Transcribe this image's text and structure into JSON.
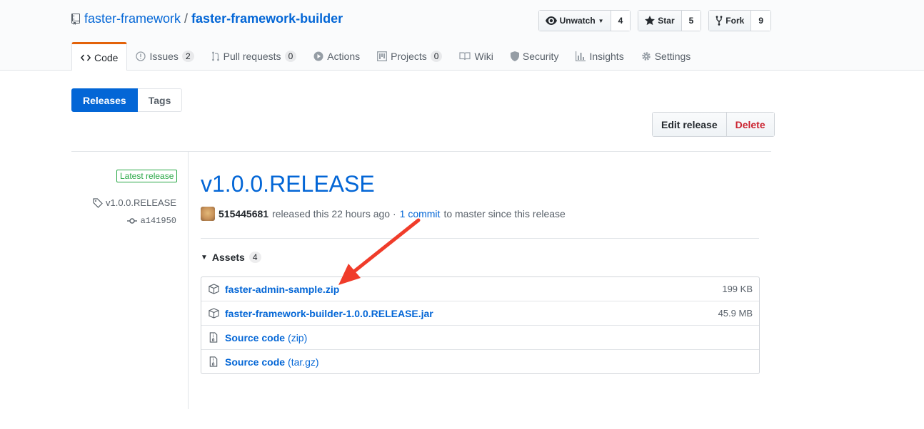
{
  "repo": {
    "owner": "faster-framework",
    "separator": "/",
    "name": "faster-framework-builder"
  },
  "header_actions": [
    {
      "label": "Unwatch",
      "count": "4",
      "icon": "eye-icon"
    },
    {
      "label": "Star",
      "count": "5",
      "icon": "star-icon"
    },
    {
      "label": "Fork",
      "count": "9",
      "icon": "fork-icon"
    }
  ],
  "tabs": [
    {
      "label": "Code",
      "icon": "code-icon",
      "selected": true
    },
    {
      "label": "Issues",
      "counter": "2",
      "icon": "issue-icon"
    },
    {
      "label": "Pull requests",
      "counter": "0",
      "icon": "pull-request-icon"
    },
    {
      "label": "Actions",
      "icon": "play-icon"
    },
    {
      "label": "Projects",
      "counter": "0",
      "icon": "project-icon"
    },
    {
      "label": "Wiki",
      "icon": "book-icon"
    },
    {
      "label": "Security",
      "icon": "shield-icon"
    },
    {
      "label": "Insights",
      "icon": "graph-icon"
    },
    {
      "label": "Settings",
      "icon": "gear-icon"
    }
  ],
  "subnav": {
    "releases": "Releases",
    "tags": "Tags"
  },
  "release_actions": {
    "edit": "Edit release",
    "delete": "Delete"
  },
  "sidebar": {
    "badge": "Latest release",
    "tag": "v1.0.0.RELEASE",
    "commit": "a141950"
  },
  "release": {
    "title": "v1.0.0.RELEASE",
    "author": "515445681",
    "released_text": "released this 22 hours ago ·",
    "commit_link": "1 commit",
    "suffix": "to master since this release"
  },
  "assets": {
    "heading": "Assets",
    "count": "4",
    "items": [
      {
        "name": "faster-admin-sample.zip",
        "size": "199 KB",
        "icon": "package-icon"
      },
      {
        "name": "faster-framework-builder-1.0.0.RELEASE.jar",
        "size": "45.9 MB",
        "icon": "package-icon"
      },
      {
        "name": "Source code",
        "ext": "(zip)",
        "icon": "file-zip-icon"
      },
      {
        "name": "Source code",
        "ext": "(tar.gz)",
        "icon": "file-zip-icon"
      }
    ]
  },
  "colors": {
    "link": "#0366d6",
    "accent_tab": "#e36209",
    "danger": "#cb2431",
    "success": "#28a745",
    "annotation_arrow": "#f03c2a"
  }
}
